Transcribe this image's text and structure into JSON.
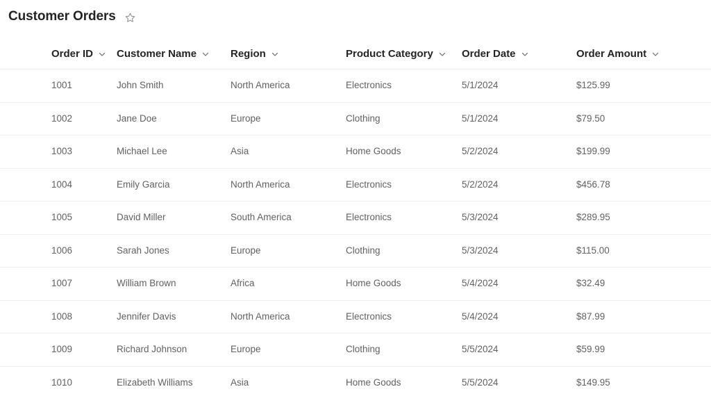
{
  "header": {
    "title": "Customer Orders",
    "favorite_icon": "star-outline-icon",
    "favorite_state": "not-favorited"
  },
  "table": {
    "columns": [
      {
        "key": "order_id",
        "label": "Order ID",
        "sort_icon": "chevron-down-icon"
      },
      {
        "key": "customer_name",
        "label": "Customer Name",
        "sort_icon": "chevron-down-icon"
      },
      {
        "key": "region",
        "label": "Region",
        "sort_icon": "chevron-down-icon"
      },
      {
        "key": "product_category",
        "label": "Product Category",
        "sort_icon": "chevron-down-icon"
      },
      {
        "key": "order_date",
        "label": "Order Date",
        "sort_icon": "chevron-down-icon"
      },
      {
        "key": "order_amount",
        "label": "Order Amount",
        "sort_icon": "chevron-down-icon"
      }
    ],
    "rows": [
      {
        "order_id": "1001",
        "customer_name": "John Smith",
        "region": "North America",
        "product_category": "Electronics",
        "order_date": "5/1/2024",
        "order_amount": "$125.99"
      },
      {
        "order_id": "1002",
        "customer_name": "Jane Doe",
        "region": "Europe",
        "product_category": "Clothing",
        "order_date": "5/1/2024",
        "order_amount": "$79.50"
      },
      {
        "order_id": "1003",
        "customer_name": "Michael Lee",
        "region": "Asia",
        "product_category": "Home Goods",
        "order_date": "5/2/2024",
        "order_amount": "$199.99"
      },
      {
        "order_id": "1004",
        "customer_name": "Emily Garcia",
        "region": "North America",
        "product_category": "Electronics",
        "order_date": "5/2/2024",
        "order_amount": "$456.78"
      },
      {
        "order_id": "1005",
        "customer_name": "David Miller",
        "region": "South America",
        "product_category": "Electronics",
        "order_date": "5/3/2024",
        "order_amount": "$289.95"
      },
      {
        "order_id": "1006",
        "customer_name": "Sarah Jones",
        "region": "Europe",
        "product_category": "Clothing",
        "order_date": "5/3/2024",
        "order_amount": "$115.00"
      },
      {
        "order_id": "1007",
        "customer_name": "William Brown",
        "region": "Africa",
        "product_category": "Home Goods",
        "order_date": "5/4/2024",
        "order_amount": "$32.49"
      },
      {
        "order_id": "1008",
        "customer_name": "Jennifer Davis",
        "region": "North America",
        "product_category": "Electronics",
        "order_date": "5/4/2024",
        "order_amount": "$87.99"
      },
      {
        "order_id": "1009",
        "customer_name": "Richard Johnson",
        "region": "Europe",
        "product_category": "Clothing",
        "order_date": "5/5/2024",
        "order_amount": "$59.99"
      },
      {
        "order_id": "1010",
        "customer_name": "Elizabeth Williams",
        "region": "Asia",
        "product_category": "Home Goods",
        "order_date": "5/5/2024",
        "order_amount": "$149.95"
      }
    ]
  },
  "colors": {
    "background": "#ffffff",
    "title_text": "#242424",
    "header_text": "#242424",
    "cell_text": "#616161",
    "divider": "#f0f0f0",
    "icon": "#616161"
  }
}
